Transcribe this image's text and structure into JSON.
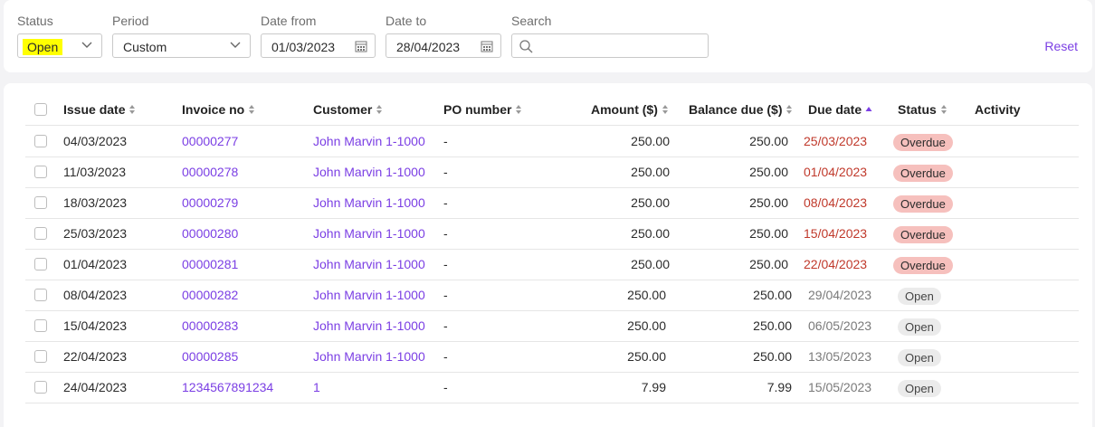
{
  "filters": {
    "status": {
      "label": "Status",
      "value": "Open"
    },
    "period": {
      "label": "Period",
      "value": "Custom"
    },
    "date_from": {
      "label": "Date from",
      "value": "01/03/2023"
    },
    "date_to": {
      "label": "Date to",
      "value": "28/04/2023"
    },
    "search": {
      "label": "Search",
      "value": "",
      "placeholder": ""
    },
    "reset_label": "Reset"
  },
  "table": {
    "columns": [
      "Issue date",
      "Invoice no",
      "Customer",
      "PO number",
      "Amount ($)",
      "Balance due ($)",
      "Due date",
      "Status",
      "Activity"
    ],
    "sorted_column": "Due date",
    "rows": [
      {
        "issue_date": "04/03/2023",
        "invoice_no": "00000277",
        "customer": "John Marvin 1-1000",
        "po_number": "-",
        "amount": "250.00",
        "balance_due": "250.00",
        "due_date": "25/03/2023",
        "status": "Overdue"
      },
      {
        "issue_date": "11/03/2023",
        "invoice_no": "00000278",
        "customer": "John Marvin 1-1000",
        "po_number": "-",
        "amount": "250.00",
        "balance_due": "250.00",
        "due_date": "01/04/2023",
        "status": "Overdue"
      },
      {
        "issue_date": "18/03/2023",
        "invoice_no": "00000279",
        "customer": "John Marvin 1-1000",
        "po_number": "-",
        "amount": "250.00",
        "balance_due": "250.00",
        "due_date": "08/04/2023",
        "status": "Overdue"
      },
      {
        "issue_date": "25/03/2023",
        "invoice_no": "00000280",
        "customer": "John Marvin 1-1000",
        "po_number": "-",
        "amount": "250.00",
        "balance_due": "250.00",
        "due_date": "15/04/2023",
        "status": "Overdue"
      },
      {
        "issue_date": "01/04/2023",
        "invoice_no": "00000281",
        "customer": "John Marvin 1-1000",
        "po_number": "-",
        "amount": "250.00",
        "balance_due": "250.00",
        "due_date": "22/04/2023",
        "status": "Overdue"
      },
      {
        "issue_date": "08/04/2023",
        "invoice_no": "00000282",
        "customer": "John Marvin 1-1000",
        "po_number": "-",
        "amount": "250.00",
        "balance_due": "250.00",
        "due_date": "29/04/2023",
        "status": "Open"
      },
      {
        "issue_date": "15/04/2023",
        "invoice_no": "00000283",
        "customer": "John Marvin 1-1000",
        "po_number": "-",
        "amount": "250.00",
        "balance_due": "250.00",
        "due_date": "06/05/2023",
        "status": "Open"
      },
      {
        "issue_date": "22/04/2023",
        "invoice_no": "00000285",
        "customer": "John Marvin 1-1000",
        "po_number": "-",
        "amount": "250.00",
        "balance_due": "250.00",
        "due_date": "13/05/2023",
        "status": "Open"
      },
      {
        "issue_date": "24/04/2023",
        "invoice_no": "1234567891234",
        "customer": "1",
        "po_number": "-",
        "amount": "7.99",
        "balance_due": "7.99",
        "due_date": "15/05/2023",
        "status": "Open"
      }
    ]
  },
  "colors": {
    "accent": "#7b3fe4",
    "overdue_text": "#c0392b",
    "overdue_badge": "#f6c0bd",
    "open_badge": "#ebebeb",
    "highlight": "#ffff00"
  },
  "icons": [
    "chevron-down-icon",
    "calendar-icon",
    "search-icon",
    "sort-icon",
    "sort-asc-icon"
  ]
}
